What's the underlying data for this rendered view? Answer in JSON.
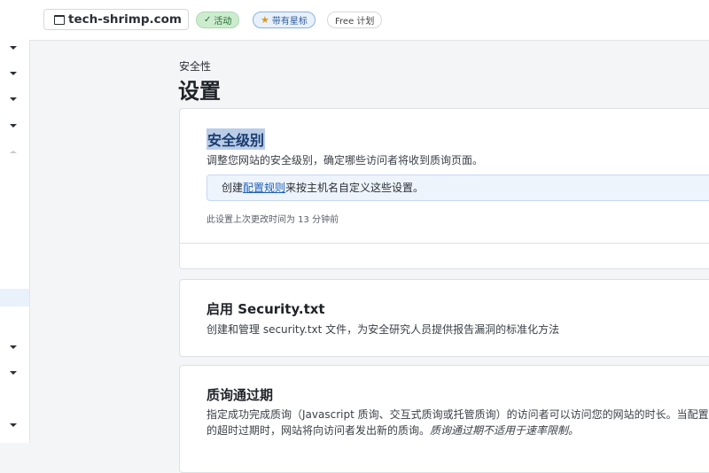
{
  "topbar": {
    "domain": "tech-shrimp.com",
    "status_badge": "活动",
    "star_badge": "带有星标",
    "plan_badge": "Free 计划"
  },
  "page": {
    "subtitle": "安全性",
    "title": "设置"
  },
  "security_level": {
    "title": "安全级别",
    "description": "调整您网站的安全级别，确定哪些访问者将收到质询页面。",
    "info_prefix": "创建",
    "info_link": "配置规则",
    "info_suffix": "来按主机名自定义这些设置。",
    "last_changed": "此设置上次更改时间为 13 分钟前"
  },
  "security_txt": {
    "title": "启用 Security.txt",
    "description": "创建和管理 security.txt 文件，为安全研究人员提供报告漏洞的标准化方法"
  },
  "challenge_passage": {
    "title": "质询通过期",
    "description": "指定成功完成质询（Javascript 质询、交互式质询或托管质询）的访问者可以访问您的网站的时长。当配置的超时过期时，网站将向访问者发出新的质询。",
    "description_italic": "质询通过期不适用于速率限制。"
  },
  "colors": {
    "accent": "#1d5fb8",
    "highlight": "#b9cde9",
    "active_badge": "#cdeccf"
  }
}
